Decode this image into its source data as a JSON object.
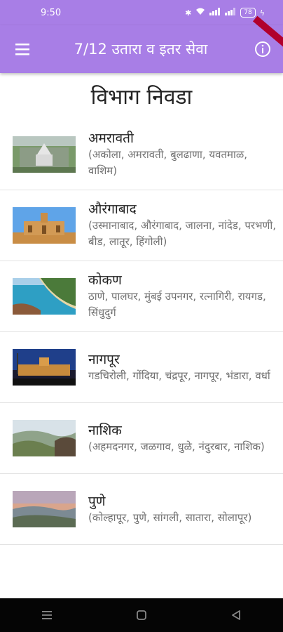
{
  "status_bar": {
    "time": "9:50",
    "battery": "78"
  },
  "app_bar": {
    "title": "7/12 उतारा व इतर सेवा"
  },
  "page": {
    "heading": "विभाग निवडा"
  },
  "divisions": [
    {
      "name": "अमरावती",
      "districts": "(अकोला, अमरावती, बुलढाणा, यवतमाळ, वाशिम)"
    },
    {
      "name": "औरंगाबाद",
      "districts": "(उस्मानाबाद, औरंगाबाद, जालना, नांदेड, परभणी, बीड, लातूर, हिंगोली)"
    },
    {
      "name": "कोकण",
      "districts": "ठाणे, पालघर, मुंबई उपनगर, रत्नागिरी, रायगड, सिंधुदुर्ग"
    },
    {
      "name": "नागपूर",
      "districts": "गडचिरोली, गोंदिया, चंद्रपूर, नागपूर, भंडारा, वर्धा"
    },
    {
      "name": "नाशिक",
      "districts": "(अहमदनगर, जळगाव, धुळे, नंदुरबार, नाशिक)"
    },
    {
      "name": "पुणे",
      "districts": "(कोल्हापूर, पुणे, सांगली, सातारा, सोलापूर)"
    }
  ]
}
